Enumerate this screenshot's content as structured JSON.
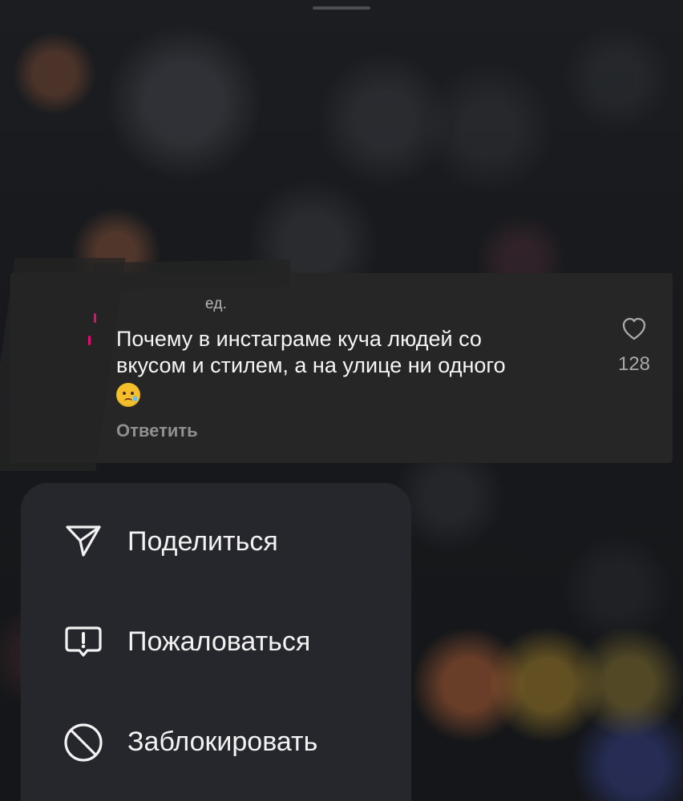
{
  "app": {
    "theme_colors": {
      "background": "#171a1e",
      "comment_card": "#262626",
      "menu_panel": "#25272d",
      "text_primary": "#f5f5f5",
      "text_secondary": "#8f8f8f",
      "accent_pink": "#e30d72"
    }
  },
  "comment": {
    "meta": "ед.",
    "text_line_1": "Почему в инстаграме куча людей со",
    "text_line_2": "вкусом и стилем, а на улице ни одного",
    "emoji": "😢",
    "reply_label": "Ответить",
    "like_icon": "heart-icon",
    "like_count": "128"
  },
  "menu": {
    "items": [
      {
        "icon": "paper-plane-icon",
        "label": "Поделиться"
      },
      {
        "icon": "report-icon",
        "label": "Пожаловаться"
      },
      {
        "icon": "block-icon",
        "label": "Заблокировать"
      }
    ]
  }
}
